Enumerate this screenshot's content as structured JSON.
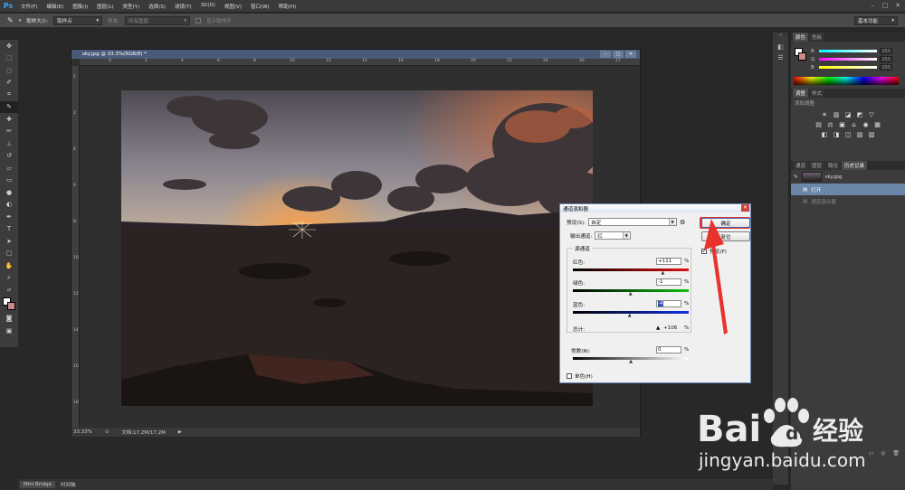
{
  "app": {
    "logo": "Ps",
    "menus": [
      "文件(F)",
      "编辑(E)",
      "图像(I)",
      "图层(L)",
      "类型(Y)",
      "选择(S)",
      "滤镜(T)",
      "3D(D)",
      "视图(V)",
      "窗口(W)",
      "帮助(H)"
    ]
  },
  "options_bar": {
    "sample_size_label": "取样大小:",
    "sample_size_value": "取样点",
    "sample_label": "样本:",
    "sample_value": "所有图层",
    "show_ring_label": "显示取样环",
    "workspace": "基本功能"
  },
  "document": {
    "title": "sky.jpg @ 33.3%(RGB/8) *",
    "ruler_ticks": [
      "0",
      "2",
      "4",
      "6",
      "8",
      "10",
      "12",
      "14",
      "16",
      "18",
      "20",
      "22",
      "24",
      "26",
      "27"
    ],
    "ruler_left_ticks": [
      "1",
      "2",
      "4",
      "6",
      "8",
      "10",
      "12",
      "14",
      "16",
      "18"
    ],
    "zoom": "33.33%",
    "doc_info": "文档:17.2M/17.2M"
  },
  "color_panel": {
    "tabs": [
      "颜色",
      "色板"
    ],
    "channels": [
      {
        "label": "R",
        "value": "255"
      },
      {
        "label": "G",
        "value": "255"
      },
      {
        "label": "B",
        "value": "255"
      }
    ]
  },
  "adjustments_panel": {
    "tabs": [
      "调整",
      "样式"
    ],
    "add_label": "添加调整"
  },
  "history_panel": {
    "tabs": [
      "通道",
      "图层",
      "路径",
      "历史记录"
    ],
    "snapshot": "sky.jpg",
    "items": [
      {
        "label": "打开"
      },
      {
        "label": "通道混合器"
      }
    ]
  },
  "bottom_bar": {
    "tabs": [
      "Mini Bridge",
      "时间轴"
    ]
  },
  "channel_mixer": {
    "title": "通道混和器",
    "preset_label": "预设(S):",
    "preset_value": "自定",
    "output_label": "输出通道:",
    "output_value": "红",
    "source_group": "源通道",
    "ok_label": "确定",
    "reset_label": "复位",
    "preview_label": "预览(P)",
    "channels": [
      {
        "label": "红色:",
        "value": "+111",
        "slider": 0.777
      },
      {
        "label": "绿色:",
        "value": "-1",
        "slider": 0.498
      },
      {
        "label": "蓝色:",
        "value": "-4",
        "slider": 0.49
      }
    ],
    "pct": "%",
    "total_label": "总计:",
    "total_value": "+106",
    "constant_label": "常数(N):",
    "constant_value": "0",
    "constant_slider": 0.5,
    "mono_label": "单色(H)"
  },
  "watermark": {
    "brand": "Bai",
    "brand_suffix": "经验",
    "url": "jingyan.baidu.com"
  },
  "colors": {
    "highlight": "#e8322c",
    "title_bar": "#4a5a78"
  }
}
